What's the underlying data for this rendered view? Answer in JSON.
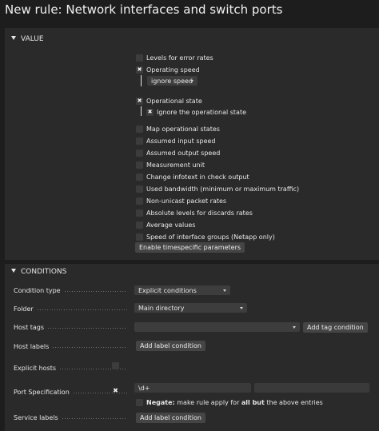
{
  "title": "New rule: Network interfaces and switch ports",
  "value_section": {
    "header": "VALUE",
    "options": [
      {
        "label": "Levels for error rates",
        "checked": false
      },
      {
        "label": "Operating speed",
        "checked": true
      },
      {
        "label": "Operational state",
        "checked": true
      },
      {
        "label": "Map operational states",
        "checked": false
      },
      {
        "label": "Assumed input speed",
        "checked": false
      },
      {
        "label": "Assumed output speed",
        "checked": false
      },
      {
        "label": "Measurement unit",
        "checked": false
      },
      {
        "label": "Change infotext in check output",
        "checked": false
      },
      {
        "label": "Used bandwidth (minimum or maximum traffic)",
        "checked": false
      },
      {
        "label": "Non-unicast packet rates",
        "checked": false
      },
      {
        "label": "Absolute levels for discards rates",
        "checked": false
      },
      {
        "label": "Average values",
        "checked": false
      },
      {
        "label": "Speed of interface groups (Netapp only)",
        "checked": false
      }
    ],
    "operating_speed_select": "ignore speed",
    "ignore_operational_state": {
      "label": "Ignore the operational state",
      "checked": true
    },
    "timespecific_button": "Enable timespecific parameters"
  },
  "conditions_section": {
    "header": "CONDITIONS",
    "condition_type": {
      "label": "Condition type",
      "value": "Explicit conditions"
    },
    "folder": {
      "label": "Folder",
      "value": "Main directory"
    },
    "host_tags": {
      "label": "Host tags",
      "value": "",
      "button": "Add tag condition"
    },
    "host_labels": {
      "label": "Host labels",
      "button": "Add label condition"
    },
    "explicit_hosts": {
      "label": "Explicit hosts",
      "checked": false
    },
    "port_specification": {
      "label": "Port Specification",
      "checked": true,
      "value": "\\d+",
      "value2": "",
      "negate_checked": false,
      "negate_prefix": "Negate:",
      "negate_text_1": " make rule apply for ",
      "negate_emph": "all but",
      "negate_text_2": " the above entries"
    },
    "service_labels": {
      "label": "Service labels",
      "button": "Add label condition"
    }
  }
}
